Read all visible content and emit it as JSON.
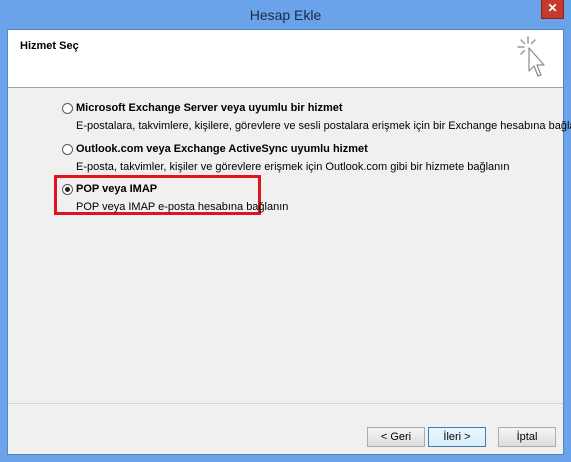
{
  "window": {
    "title": "Hesap Ekle",
    "close_glyph": "✕"
  },
  "header": {
    "title": "Hizmet Seç",
    "icon": "cursor-sparkle-icon"
  },
  "options": [
    {
      "label": "Microsoft Exchange Server veya uyumlu bir hizmet",
      "description": "E-postalara, takvimlere, kişilere, görevlere ve sesli postalara erişmek için bir Exchange hesabına bağlanın",
      "selected": false
    },
    {
      "label": "Outlook.com veya Exchange ActiveSync uyumlu hizmet",
      "description": "E-posta, takvimler, kişiler ve görevlere erişmek için Outlook.com gibi bir hizmete bağlanın",
      "selected": false
    },
    {
      "label": "POP veya IMAP",
      "description": "POP veya IMAP e-posta hesabına bağlanın",
      "selected": true
    }
  ],
  "buttons": {
    "back": "< Geri",
    "next": "İleri >",
    "cancel": "İptal"
  },
  "colors": {
    "highlight": "#e0141e",
    "title_bar": "#6aa3ea"
  }
}
